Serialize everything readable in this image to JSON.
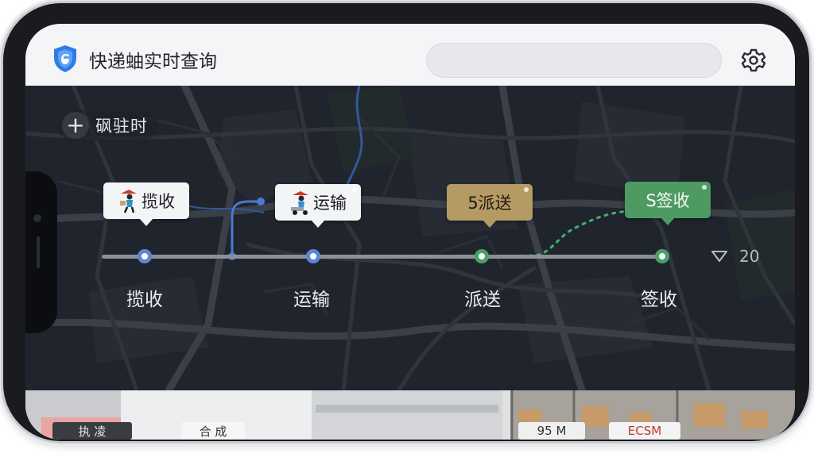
{
  "header": {
    "app_title": "快递蚰实时查询",
    "search_value": "",
    "search_placeholder": ""
  },
  "map": {
    "add_label": "砜驻时",
    "counter_value": "20"
  },
  "timeline": {
    "stages": [
      {
        "label": "揽收",
        "card": "揽收",
        "state": "done"
      },
      {
        "label": "运输",
        "card": "运输",
        "state": "done"
      },
      {
        "label": "派送",
        "card": "5派送",
        "state": "current"
      },
      {
        "label": "签收",
        "card": "S签收",
        "state": "pending"
      }
    ]
  },
  "strip": {
    "chips": [
      "执 凌",
      "合 成",
      "95 M",
      "ECSM"
    ]
  },
  "colors": {
    "header_bg": "#f4f5f7",
    "map_bg": "#20252d",
    "accent_blue": "#5c86d8",
    "accent_green": "#4aa264",
    "card_gold": "#b69a64",
    "card_green": "#4d9b62"
  },
  "icons": {
    "app_logo": "shield-icon",
    "settings": "gear-icon",
    "add": "plus-icon",
    "counter": "triangle-down-icon",
    "courier": "courier-icon"
  }
}
